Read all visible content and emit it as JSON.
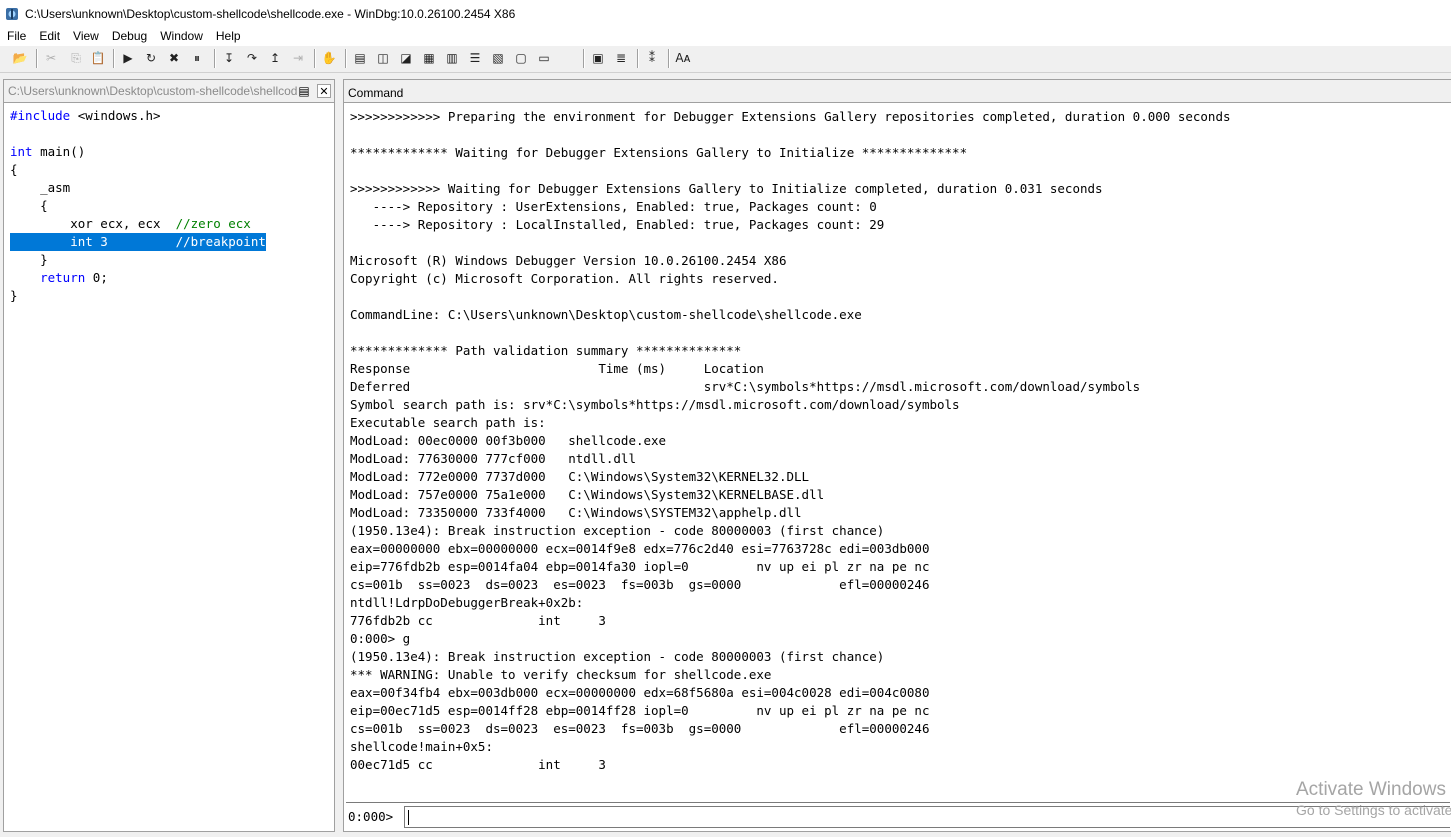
{
  "window": {
    "title": "C:\\Users\\unknown\\Desktop\\custom-shellcode\\shellcode.exe - WinDbg:10.0.26100.2454 X86",
    "icon": "windbg-app-icon"
  },
  "menu": [
    "File",
    "Edit",
    "View",
    "Debug",
    "Window",
    "Help"
  ],
  "toolbar": {
    "icons": [
      {
        "name": "open-icon",
        "glyph": "📂",
        "enabled": true
      },
      {
        "name": "cut-icon",
        "glyph": "✂",
        "enabled": false
      },
      {
        "name": "copy-icon",
        "glyph": "⎘",
        "enabled": false
      },
      {
        "name": "paste-icon",
        "glyph": "📋",
        "enabled": true
      },
      {
        "name": "go-icon",
        "glyph": "▶",
        "enabled": true
      },
      {
        "name": "restart-icon",
        "glyph": "↻",
        "enabled": true
      },
      {
        "name": "stop-debugging-icon",
        "glyph": "✖",
        "enabled": true
      },
      {
        "name": "break-icon",
        "glyph": "⏸",
        "enabled": true
      },
      {
        "name": "step-into-icon",
        "glyph": "↧",
        "enabled": true
      },
      {
        "name": "step-over-icon",
        "glyph": "↷",
        "enabled": true
      },
      {
        "name": "step-out-icon",
        "glyph": "↥",
        "enabled": true
      },
      {
        "name": "run-to-cursor-icon",
        "glyph": "⇥",
        "enabled": false
      },
      {
        "name": "breakpoint-hand-icon",
        "glyph": "✋",
        "enabled": true
      },
      {
        "name": "command-window-icon",
        "glyph": "▤",
        "enabled": true
      },
      {
        "name": "watch-window-icon",
        "glyph": "◫",
        "enabled": true
      },
      {
        "name": "locals-window-icon",
        "glyph": "◪",
        "enabled": true
      },
      {
        "name": "registers-window-icon",
        "glyph": "▦",
        "enabled": true
      },
      {
        "name": "memory-window-icon",
        "glyph": "▥",
        "enabled": true
      },
      {
        "name": "call-stack-window-icon",
        "glyph": "☰",
        "enabled": true
      },
      {
        "name": "disassembly-window-icon",
        "glyph": "▧",
        "enabled": true
      },
      {
        "name": "scratch-pad-icon",
        "glyph": "▢",
        "enabled": true
      },
      {
        "name": "processes-threads-icon",
        "glyph": "▭",
        "enabled": true
      },
      {
        "name": "source-mode-icon",
        "glyph": "▣",
        "enabled": true
      },
      {
        "name": "source-mode-toggle-icon",
        "glyph": "≣",
        "enabled": true
      },
      {
        "name": "hex-mode-icon",
        "glyph": "⁑",
        "enabled": true
      },
      {
        "name": "font-icon",
        "glyph": "Aᴀ",
        "enabled": true
      },
      {
        "name": "options-icon",
        "glyph": "▩",
        "enabled": true
      }
    ]
  },
  "source_pane": {
    "path": "C:\\Users\\unknown\\Desktop\\custom-shellcode\\shellcode.c",
    "close_label": "✕",
    "lines": [
      {
        "kw": "#include",
        "rest": " <windows.h>"
      },
      {
        "text": ""
      },
      {
        "kw": "int",
        "rest": " main()"
      },
      {
        "text": "{"
      },
      {
        "text": "    _asm"
      },
      {
        "text": "    {"
      },
      {
        "code": "        xor ecx, ecx  ",
        "comment": "//zero ecx"
      },
      {
        "code": "        int 3         ",
        "comment": "//breakpoint",
        "selected": true
      },
      {
        "text": "    }"
      },
      {
        "kw_indent": "    ",
        "kw": "return",
        "rest": " 0;"
      },
      {
        "text": "}"
      }
    ]
  },
  "command_pane": {
    "title": "Command",
    "prompt": "0:000>",
    "input_value": "",
    "output": [
      ">>>>>>>>>>>> Preparing the environment for Debugger Extensions Gallery repositories completed, duration 0.000 seconds",
      "",
      "************* Waiting for Debugger Extensions Gallery to Initialize **************",
      "",
      ">>>>>>>>>>>> Waiting for Debugger Extensions Gallery to Initialize completed, duration 0.031 seconds",
      "   ----> Repository : UserExtensions, Enabled: true, Packages count: 0",
      "   ----> Repository : LocalInstalled, Enabled: true, Packages count: 29",
      "",
      "Microsoft (R) Windows Debugger Version 10.0.26100.2454 X86",
      "Copyright (c) Microsoft Corporation. All rights reserved.",
      "",
      "CommandLine: C:\\Users\\unknown\\Desktop\\custom-shellcode\\shellcode.exe",
      "",
      "************* Path validation summary **************",
      "Response                         Time (ms)     Location",
      "Deferred                                       srv*C:\\symbols*https://msdl.microsoft.com/download/symbols",
      "Symbol search path is: srv*C:\\symbols*https://msdl.microsoft.com/download/symbols",
      "Executable search path is: ",
      "ModLoad: 00ec0000 00f3b000   shellcode.exe",
      "ModLoad: 77630000 777cf000   ntdll.dll",
      "ModLoad: 772e0000 7737d000   C:\\Windows\\System32\\KERNEL32.DLL",
      "ModLoad: 757e0000 75a1e000   C:\\Windows\\System32\\KERNELBASE.dll",
      "ModLoad: 73350000 733f4000   C:\\Windows\\SYSTEM32\\apphelp.dll",
      "(1950.13e4): Break instruction exception - code 80000003 (first chance)",
      "eax=00000000 ebx=00000000 ecx=0014f9e8 edx=776c2d40 esi=7763728c edi=003db000",
      "eip=776fdb2b esp=0014fa04 ebp=0014fa30 iopl=0         nv up ei pl zr na pe nc",
      "cs=001b  ss=0023  ds=0023  es=0023  fs=003b  gs=0000             efl=00000246",
      "ntdll!LdrpDoDebuggerBreak+0x2b:",
      "776fdb2b cc              int     3",
      "0:000> g",
      "(1950.13e4): Break instruction exception - code 80000003 (first chance)",
      "*** WARNING: Unable to verify checksum for shellcode.exe",
      "eax=00f34fb4 ebx=003db000 ecx=00000000 edx=68f5680a esi=004c0028 edi=004c0080",
      "eip=00ec71d5 esp=0014ff28 ebp=0014ff28 iopl=0         nv up ei pl zr na pe nc",
      "cs=001b  ss=0023  ds=0023  es=0023  fs=003b  gs=0000             efl=00000246",
      "shellcode!main+0x5:",
      "00ec71d5 cc              int     3"
    ]
  },
  "watermark": {
    "line1": "Activate Windows",
    "line2": "Go to Settings to activate Windows."
  },
  "colors": {
    "selection": "#0078d7",
    "keyword": "#0000ff",
    "comment": "#008000"
  }
}
